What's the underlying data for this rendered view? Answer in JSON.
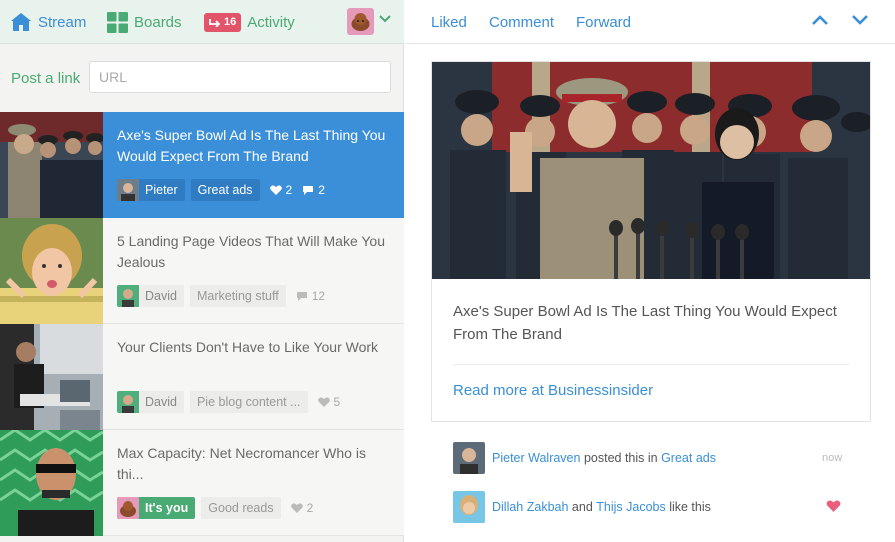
{
  "nav": {
    "stream": "Stream",
    "boards": "Boards",
    "activity_count": "16",
    "activity": "Activity"
  },
  "post_link": {
    "label": "Post a link",
    "placeholder": "URL"
  },
  "feed": [
    {
      "title": "Axe's Super Bowl Ad Is The Last Thing You Would Expect From The Brand",
      "user": "Pieter",
      "board": "Great ads",
      "likes": "2",
      "comments": "2"
    },
    {
      "title": "5 Landing Page Videos That Will Make You Jealous",
      "user": "David",
      "board": "Marketing stuff",
      "comments": "12"
    },
    {
      "title": "Your Clients Don't Have to Like Your Work",
      "user": "David",
      "board": "Pie blog content ...",
      "likes": "5"
    },
    {
      "title": "Max Capacity: Net Necromancer Who is thi...",
      "user": "It's you",
      "board": "Good reads",
      "likes": "2"
    }
  ],
  "toolbar": {
    "liked": "Liked",
    "comment": "Comment",
    "forward": "Forward"
  },
  "detail": {
    "title": "Axe's Super Bowl Ad Is The Last Thing You Would Expect From The Brand",
    "read_more": "Read more at Businessinsider"
  },
  "activity": [
    {
      "actor": "Pieter Walraven",
      "text": " posted this in ",
      "target": "Great ads",
      "time": "now"
    },
    {
      "actor": "Dillah Zakbah",
      "text": " and ",
      "actor2": "Thijs Jacobs",
      "text2": " like this"
    }
  ],
  "colors": {
    "accent_blue": "#3b8fd9",
    "accent_green": "#4aaa73",
    "badge_red": "#e2546a",
    "heart_pink": "#ec5c7d"
  }
}
